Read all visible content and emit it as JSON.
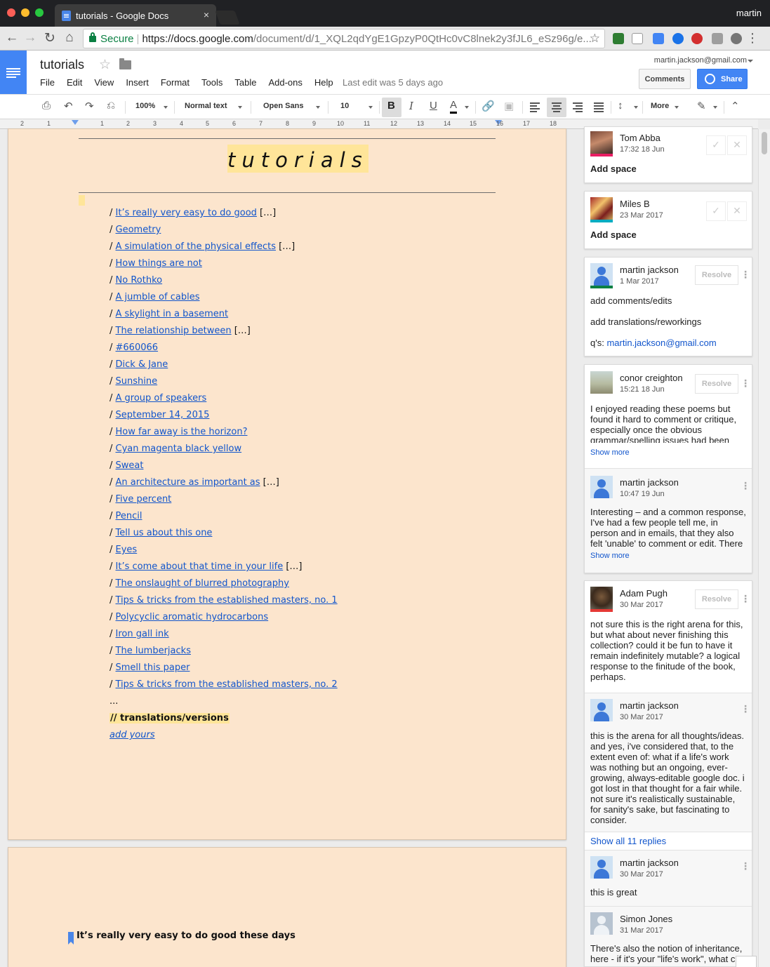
{
  "browser": {
    "tab_title": "tutorials - Google Docs",
    "tab_close": "×",
    "profile_name": "martin",
    "secure_label": "Secure",
    "url_host": "https://docs.google.com",
    "url_path": "/document/d/1_XQL2qdYgE1GpzyP0QtHc0vC8lnek2y3fJL6_eSz96g/e..."
  },
  "doc": {
    "title": "tutorials",
    "menu": [
      "File",
      "Edit",
      "View",
      "Insert",
      "Format",
      "Tools",
      "Table",
      "Add-ons",
      "Help"
    ],
    "last_edit": "Last edit was 5 days ago",
    "account": "martin.jackson@gmail.com",
    "comments_label": "Comments",
    "share_label": "Share"
  },
  "toolbar": {
    "zoom": "100%",
    "style": "Normal text",
    "font": "Open Sans",
    "size": "10",
    "more": "More"
  },
  "ruler": {
    "numbers": [
      "2",
      "1",
      "1",
      "1",
      "2",
      "3",
      "4",
      "5",
      "6",
      "7",
      "8",
      "9",
      "10",
      "11",
      "12",
      "13",
      "14",
      "15",
      "16",
      "17",
      "18"
    ]
  },
  "page": {
    "title": "tutorials",
    "entries": [
      {
        "slash": "/ ",
        "link": "It’s really very easy to do good",
        "tail": " […]"
      },
      {
        "slash": "/ ",
        "link": "Geometry",
        "tail": ""
      },
      {
        "slash": "/ ",
        "link": "A simulation of the physical effects",
        "tail": " […]"
      },
      {
        "slash": "/ ",
        "link": "How things are not",
        "tail": ""
      },
      {
        "slash": "/ ",
        "link": "No Rothko",
        "tail": ""
      },
      {
        "slash": "/ ",
        "link": "A jumble of cables",
        "tail": ""
      },
      {
        "slash": "/ ",
        "link": "A skylight in a basement",
        "tail": ""
      },
      {
        "slash": "/ ",
        "link": "The relationship between",
        "tail": " […]"
      },
      {
        "slash": "/ ",
        "link": "#660066",
        "tail": ""
      },
      {
        "slash": "/ ",
        "link": "Dick & Jane",
        "tail": ""
      },
      {
        "slash": "/ ",
        "link": "Sunshine",
        "tail": ""
      },
      {
        "slash": "/ ",
        "link": "A group of speakers",
        "tail": ""
      },
      {
        "slash": "/ ",
        "link": "September 14, 2015",
        "tail": ""
      },
      {
        "slash": "/ ",
        "link": "How far away is the horizon?",
        "tail": ""
      },
      {
        "slash": "/ ",
        "link": "Cyan magenta black yellow",
        "tail": ""
      },
      {
        "slash": "/ ",
        "link": "Sweat",
        "tail": ""
      },
      {
        "slash": "/ ",
        "link": "An architecture as important as",
        "tail": " […]"
      },
      {
        "slash": "/ ",
        "link": "Five percent",
        "tail": ""
      },
      {
        "slash": "/ ",
        "link": "Pencil",
        "tail": ""
      },
      {
        "slash": "/ ",
        "link": "Tell us about this one",
        "tail": ""
      },
      {
        "slash": "/ ",
        "link": "Eyes",
        "tail": ""
      },
      {
        "slash": "/ ",
        "link": "It’s come about that time in your life",
        "tail": " […]"
      },
      {
        "slash": "/ ",
        "link": "The onslaught of blurred photography",
        "tail": ""
      },
      {
        "slash": "/ ",
        "link": "Tips & tricks from the established masters, no. 1",
        "tail": ""
      },
      {
        "slash": "/ ",
        "link": "Polycyclic aromatic hydrocarbons",
        "tail": ""
      },
      {
        "slash": "/ ",
        "link": "Iron gall ink",
        "tail": ""
      },
      {
        "slash": "/ ",
        "link": "The lumberjacks",
        "tail": ""
      },
      {
        "slash": "/ ",
        "link": "Smell this paper",
        "tail": ""
      },
      {
        "slash": "/ ",
        "link": "Tips & tricks from the established masters, no. 2",
        "tail": ""
      }
    ],
    "ellipsis": "...",
    "translations": "// translations/versions",
    "add_yours": "add yours",
    "page2_heading": "It’s really very easy to do good these days"
  },
  "comments": {
    "c1": {
      "author": "Tom Abba",
      "date": "17:32 18 Jun",
      "body": "Add space",
      "check": "✓",
      "close": "✕"
    },
    "c2": {
      "author": "Miles B",
      "date": "23 Mar 2017",
      "body": "Add space",
      "check": "✓",
      "close": "✕"
    },
    "c3": {
      "author": "martin jackson",
      "date": "1 Mar 2017",
      "resolve": "Resolve",
      "line1": "add comments/edits",
      "line2": "add translations/reworkings",
      "line3_prefix": "q's: ",
      "line3_link": "martin.jackson@gmail.com"
    },
    "c4": {
      "author": "conor creighton",
      "date": "15:21 18 Jun",
      "resolve": "Resolve",
      "body": "I enjoyed reading these poems but found it hard to comment or critique, especially once the obvious grammar/spelling issues had been",
      "show_more": "Show more"
    },
    "c4r1": {
      "author": "martin jackson",
      "date": "10:47 19 Jun",
      "body": "Interesting – and a common response, I've had a few people tell me, in person and in emails, that they also felt 'unable' to comment or edit. There",
      "show_more": "Show more"
    },
    "c5": {
      "author": "Adam Pugh",
      "date": "30 Mar 2017",
      "resolve": "Resolve",
      "body": "not sure this is the right arena for this, but what about never finishing this collection? could it be fun to have it remain indefinitely mutable? a logical response to the finitude of the book, perhaps."
    },
    "c5r1": {
      "author": "martin jackson",
      "date": "30 Mar 2017",
      "body": "this is the arena for all thoughts/ideas. and yes, i've considered that, to the extent even of: what if a life's work was nothing but an ongoing, ever-growing, always-editable google doc. i got lost in that thought for a fair while. not sure it's realistically sustainable, for sanity's sake, but fascinating to consider."
    },
    "show_all": "Show all 11 replies",
    "c5r2": {
      "author": "martin jackson",
      "date": "30 Mar 2017",
      "body": "this is great"
    },
    "c5r3": {
      "author": "Simon Jones",
      "date": "31 Mar 2017",
      "body": "There's also the notion of inheritance, here - if it's your \"life's work\", what c"
    }
  },
  "colors": {
    "page_bg": "#fce5cd",
    "highlight": "#ffe599",
    "link": "#1155cc",
    "docs_blue": "#4285f4"
  }
}
